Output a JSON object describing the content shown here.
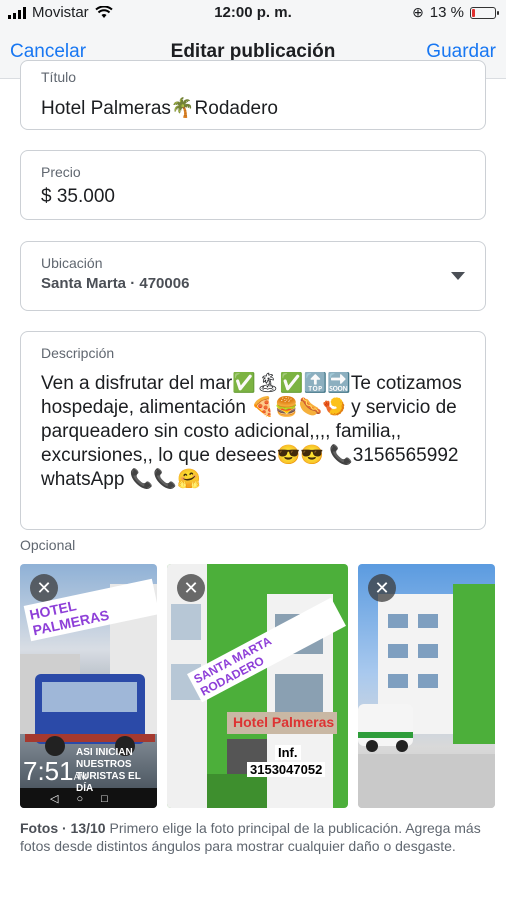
{
  "status_bar": {
    "carrier": "Movistar",
    "time": "12:00 p. m.",
    "battery_text": "13 %",
    "battery_level": 0.13
  },
  "navbar": {
    "cancel_label": "Cancelar",
    "title": "Editar publicación",
    "save_label": "Guardar"
  },
  "form": {
    "title_label": "Título",
    "title_value": "Hotel Palmeras🌴Rodadero",
    "price_label": "Precio",
    "price_value": "$ 35.000",
    "location_label": "Ubicación",
    "location_value": "Santa Marta · 470006",
    "description_label": "Descripción",
    "description_value": "Ven a disfrutar del mar✅🏝✅🔝🔜Te cotizamos hospedaje, alimentación 🍕🍔🌭🍤 y servicio de parqueadero sin costo adicional,,,, familia,, excursiones,, lo que desees😎😎 📞3156565992 whatsApp 📞📞🤗"
  },
  "optional_label": "Opcional",
  "photos": [
    {
      "close_icon": "✕",
      "overlay_top": "HOTEL PALMERAS",
      "overlay_bottom": "ASI INICIAN NUESTROS TURISTAS EL DÍA",
      "clock": "7:51",
      "clock_suffix": "AM"
    },
    {
      "close_icon": "✕",
      "overlay_top": "SANTA MARTA RODADERO",
      "sign": "Hotel Palmeras",
      "inf_label": "Inf.",
      "phone": "3153047052"
    },
    {
      "close_icon": "✕"
    }
  ],
  "footer": {
    "count": "Fotos · 13/10",
    "text": " Primero elige la foto principal de la publicación. Agrega más fotos desde distintos ángulos para mostrar cualquier daño o desgaste."
  },
  "colors": {
    "accent": "#1877f2",
    "battery_low": "#e0312f",
    "building_green": "#4caf3a"
  }
}
